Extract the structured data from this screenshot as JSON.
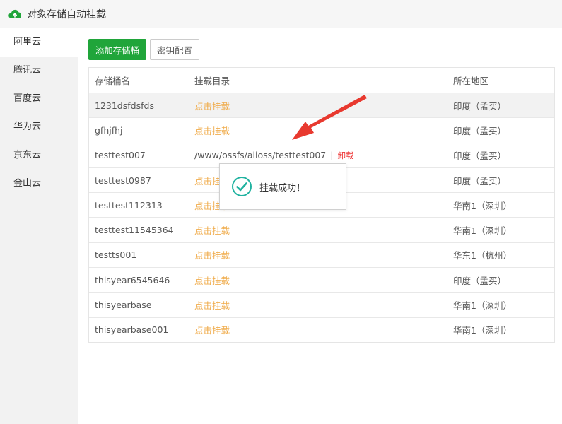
{
  "app": {
    "title": "对象存储自动挂载"
  },
  "sidebar": {
    "items": [
      {
        "label": "阿里云"
      },
      {
        "label": "腾讯云"
      },
      {
        "label": "百度云"
      },
      {
        "label": "华为云"
      },
      {
        "label": "京东云"
      },
      {
        "label": "金山云"
      }
    ],
    "active_index": 0
  },
  "toolbar": {
    "add_label": "添加存储桶",
    "key_label": "密钥配置"
  },
  "table": {
    "headers": [
      "存储桶名",
      "挂载目录",
      "所在地区"
    ],
    "mount_action": "点击挂载",
    "unmount_action": "卸载",
    "rows": [
      {
        "name": "1231dsfdsfds",
        "region": "印度（孟买）"
      },
      {
        "name": "gfhjfhj",
        "region": "印度（孟买）"
      },
      {
        "name": "testtest007",
        "mounted_path": "/www/ossfs/alioss/testtest007",
        "region": "印度（孟买）"
      },
      {
        "name": "testtest0987",
        "region": "印度（孟买）"
      },
      {
        "name": "testtest112313",
        "region": "华南1（深圳）"
      },
      {
        "name": "testtest11545364",
        "region": "华南1（深圳）"
      },
      {
        "name": "testts001",
        "region": "华东1（杭州）"
      },
      {
        "name": "thisyear6545646",
        "region": "印度（孟买）"
      },
      {
        "name": "thisyearbase",
        "region": "华南1（深圳）"
      },
      {
        "name": "thisyearbase001",
        "region": "华南1（深圳）"
      }
    ]
  },
  "toast": {
    "message": "挂载成功！",
    "icon": "check-circle-icon"
  },
  "colors": {
    "accent": "#20a53a",
    "link": "#f0ad4e",
    "danger": "#e33333",
    "arrow": "#e8392f"
  }
}
